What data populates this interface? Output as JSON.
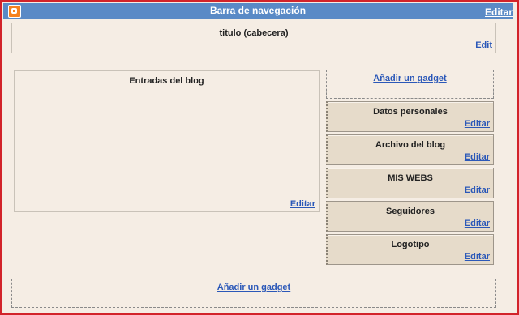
{
  "navbar": {
    "title": "Barra de navegación",
    "edit_label": "Editar"
  },
  "header": {
    "title": "titulo (cabecera)",
    "edit_label": "Edit"
  },
  "main": {
    "title": "Entradas del blog",
    "edit_label": "Editar"
  },
  "sidebar": {
    "add_gadget_label": "Añadir un gadget",
    "gadgets": [
      {
        "title": "Datos personales",
        "edit_label": "Editar"
      },
      {
        "title": "Archivo del blog",
        "edit_label": "Editar"
      },
      {
        "title": "MIS WEBS",
        "edit_label": "Editar"
      },
      {
        "title": "Seguidores",
        "edit_label": "Editar"
      },
      {
        "title": "Logotipo",
        "edit_label": "Editar"
      }
    ]
  },
  "footer": {
    "add_gadget_label": "Añadir un gadget"
  },
  "colors": {
    "navbar": "#5a8ac6",
    "background": "#f5ede4",
    "gadget": "#e6dbca",
    "link": "#2b58b8",
    "frame_border": "#d2232a"
  }
}
